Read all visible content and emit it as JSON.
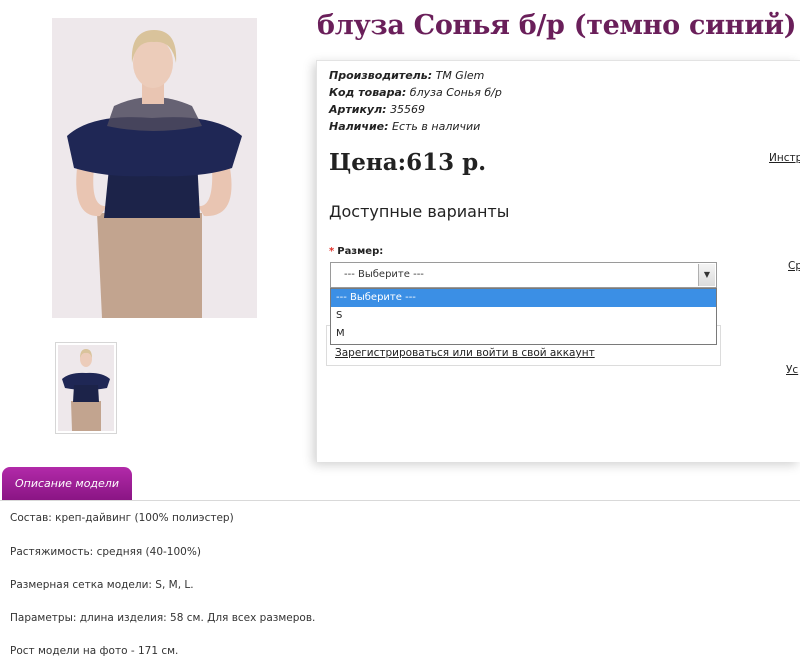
{
  "product": {
    "title": "блуза Сонья б/р (темно синий)",
    "main_image_alt": "Фото блузы",
    "thumbnail_alt": "Миниатюра блузы"
  },
  "meta": {
    "manufacturer_label": "Производитель:",
    "manufacturer_value": "TM Glem",
    "code_label": "Код товара:",
    "code_value": "блуза Сонья б/р",
    "sku_label": "Артикул:",
    "sku_value": "35569",
    "availability_label": "Наличие:",
    "availability_value": "Есть в наличии"
  },
  "price": "Цена:613 р.",
  "variants": {
    "heading": "Доступные варианты",
    "required_mark": "*",
    "size_label": "Размер:",
    "selected": "--- Выберите ---",
    "options": [
      "--- Выберите ---",
      "S",
      "M"
    ]
  },
  "login_link": "Зарегистрироваться или войти в свой аккаунт",
  "side_links": [
    "Инстр",
    "Ср",
    "Ус"
  ],
  "tab_label": "Описание модели",
  "description": [
    {
      "label": "Состав:",
      "text": "креп-дайвинг (100% полиэстер)"
    },
    {
      "label": "Растяжимость:",
      "text": "средняя (40-100%)"
    },
    {
      "label": "Размерная сетка модели:",
      "text": "S, M, L."
    },
    {
      "label": "Параметры:",
      "text": "длина изделия: 58 см. Для всех размеров."
    },
    {
      "label": "Рост модели на фото",
      "text": "- 171 см."
    }
  ],
  "colors": {
    "title": "#6a1f5a",
    "tab": "#9b1f92",
    "dropdown_highlight": "#3b8fe5",
    "required": "#e0322a"
  }
}
